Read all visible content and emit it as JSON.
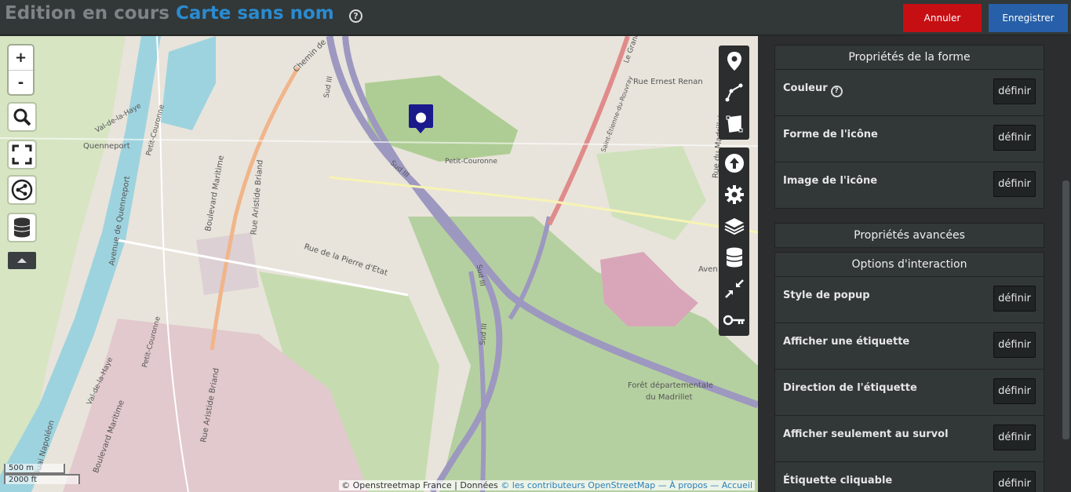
{
  "header": {
    "title_prefix": "Edition en cours",
    "map_name": "Carte sans nom",
    "help_symbol": "?",
    "cancel_label": "Annuler",
    "save_label": "Enregistrer"
  },
  "map": {
    "zoom_in": "+",
    "zoom_out": "-",
    "controls": [
      "search-icon",
      "fullscreen-icon",
      "share-icon",
      "datalayers-icon"
    ],
    "more_icon": "caret-up-icon",
    "scale_metric": "500 m",
    "scale_imperial": "2000 ft",
    "attribution": {
      "prefix": "© Openstreetmap France | Données",
      "link_contributors": "© les contributeurs OpenStreetMap",
      "sep1": " — ",
      "link_about": "À propos",
      "sep2": " — ",
      "link_home": "Accueil"
    },
    "labels": {
      "quenneport": "Quenneport",
      "val_de_haye_1": "Val-de-la-Haye",
      "val_de_haye_2": "Val-de-la-Haye",
      "petit_couronne_1": "Petit-Couronne",
      "petit_couronne_2": "Petit-Couronne",
      "petit_couronne_3": "Petit-Couronne",
      "av_quenneport": "Avenue de Quenneport",
      "bd_maritime_1": "Boulevard Maritime",
      "bd_maritime_2": "Boulevard Maritime",
      "rue_briand_1": "Rue Aristide Briand",
      "rue_briand_2": "Rue Aristide Briand",
      "rue_pierre": "Rue de la Pierre d'Etat",
      "sud3_1": "Sud III",
      "sud3_2": "Sud III",
      "sud3_3": "Sud III",
      "sud3_4": "Sud III",
      "rue_renan": "Rue Ernest Renan",
      "rue_madrillet": "Rue du Madrillet",
      "st_etienne": "Saint-Étienne-du-Rouvray",
      "chemin": "Chemin de",
      "foret_1": "Forêt départementale",
      "foret_2": "du Madrillet",
      "quai": "Quai Napoléon",
      "le_grand": "Le Grand",
      "avenue": "Aven"
    },
    "toolbar_draw": [
      "marker-icon",
      "polyline-icon",
      "polygon-icon"
    ],
    "toolbar_settings": [
      "upload-icon",
      "gear-icon",
      "layers-icon",
      "database-icon",
      "compress-icon",
      "key-icon"
    ]
  },
  "panel": {
    "shape_properties": {
      "title": "Propriétés de la forme",
      "rows": [
        {
          "label": "Couleur",
          "button": "définir",
          "help": "?"
        },
        {
          "label": "Forme de l'icône",
          "button": "définir"
        },
        {
          "label": "Image de l'icône",
          "button": "définir"
        }
      ]
    },
    "advanced_properties": {
      "title": "Propriétés avancées"
    },
    "interaction_options": {
      "title": "Options d'interaction",
      "rows": [
        {
          "label": "Style de popup",
          "button": "définir"
        },
        {
          "label": "Afficher une étiquette",
          "button": "définir"
        },
        {
          "label": "Direction de l'étiquette",
          "button": "définir"
        },
        {
          "label": "Afficher seulement au survol",
          "button": "définir"
        },
        {
          "label": "Étiquette cliquable",
          "button": "définir"
        }
      ]
    }
  },
  "colors": {
    "cancel": "#c60f13",
    "save": "#2760a8",
    "title_name": "#2a8bd0",
    "marker": "#1a1a8c"
  }
}
